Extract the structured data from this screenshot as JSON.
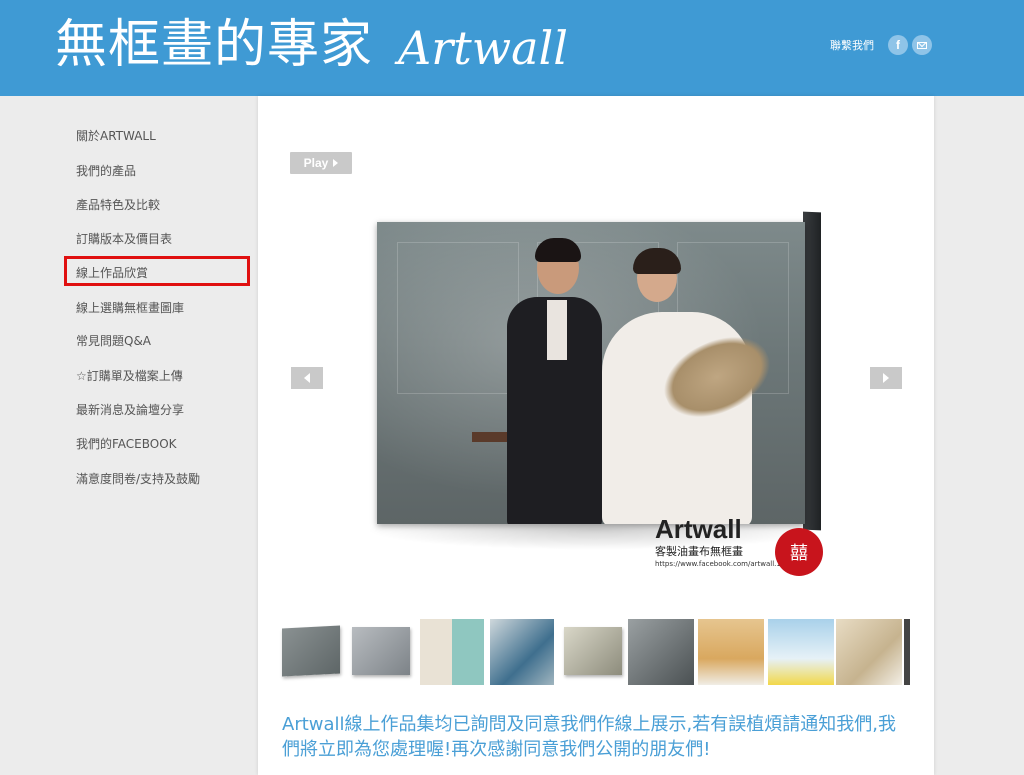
{
  "header": {
    "title": "無框畫的專家",
    "script_title": "Artwall",
    "contact_link": "聯繫我們",
    "facebook_icon": "f",
    "email_icon": "mail",
    "background_color": "#3f9ad4"
  },
  "sidebar": {
    "items": [
      {
        "label": "關於ARTWALL"
      },
      {
        "label": "我們的產品"
      },
      {
        "label": "產品特色及比較"
      },
      {
        "label": "訂購版本及價目表"
      },
      {
        "label": "線上作品欣賞",
        "selected": true
      },
      {
        "label": "線上選購無框畫圖庫"
      },
      {
        "label": "常見問題Q&A"
      },
      {
        "label": "☆訂購單及檔案上傳"
      },
      {
        "label": "最新消息及論壇分享"
      },
      {
        "label": "我們的FACEBOOK"
      },
      {
        "label": "滿意度問卷/支持及鼓勵"
      }
    ],
    "highlight_color": "#e01010"
  },
  "slideshow": {
    "play_label": "Play",
    "brand_name": "Artwall",
    "brand_subtitle": "客製油畫布無框畫",
    "brand_url": "https://www.facebook.com/artwall.101",
    "seal_glyph": "囍",
    "thumbnail_count": 10
  },
  "footer": {
    "text": "Artwall線上作品集均已詢問及同意我們作線上展示,若有誤植煩請通知我們,我們將立即為您處理喔!再次感謝同意我們公開的朋友們!",
    "color": "#4a9fd6"
  }
}
